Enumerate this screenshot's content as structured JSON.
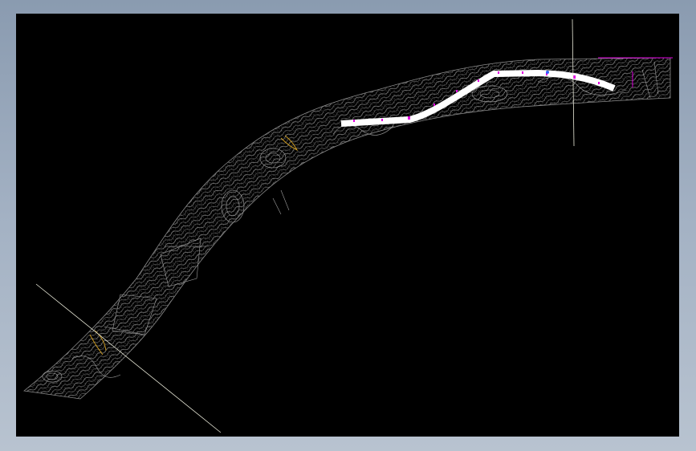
{
  "drawing": {
    "background_color": "#000000",
    "frame_color": "#9aa9bb",
    "terrain_color": "#8c8c8c",
    "road_color": "#ffffff",
    "marker_color": "#e000e0",
    "crosshair_color": "#e8e8d8",
    "annotation_color": "#d4a020"
  }
}
